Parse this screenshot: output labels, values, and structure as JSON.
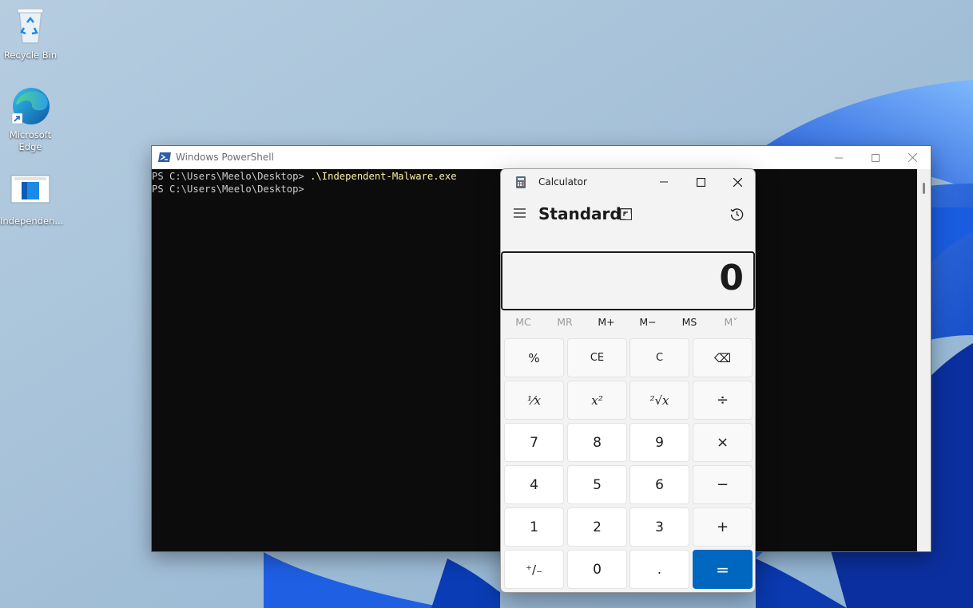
{
  "desktop": {
    "icons": [
      {
        "label": "Recycle Bin"
      },
      {
        "label": "Microsoft Edge"
      },
      {
        "label": "Independen..."
      }
    ]
  },
  "powershell": {
    "title": "Windows PowerShell",
    "lines": [
      "PS C:\\Users\\Meelo\\Desktop> .\\Independent-Malware.exe",
      "PS C:\\Users\\Meelo\\Desktop>"
    ],
    "controls": [
      "minimize-icon",
      "maximize-icon",
      "close-icon"
    ]
  },
  "calculator": {
    "title": "Calculator",
    "mode": "Standard",
    "display": "0",
    "memory": [
      {
        "label": "MC",
        "enabled": false
      },
      {
        "label": "MR",
        "enabled": false
      },
      {
        "label": "M+",
        "enabled": true
      },
      {
        "label": "M−",
        "enabled": true
      },
      {
        "label": "MS",
        "enabled": true
      },
      {
        "label": "M˅",
        "enabled": false
      }
    ],
    "keys": [
      {
        "label": "%"
      },
      {
        "label": "CE"
      },
      {
        "label": "C"
      },
      {
        "label": "⌫"
      },
      {
        "label": "⅟x"
      },
      {
        "label": "x²"
      },
      {
        "label": "²√x"
      },
      {
        "label": "÷"
      },
      {
        "label": "7"
      },
      {
        "label": "8"
      },
      {
        "label": "9"
      },
      {
        "label": "×"
      },
      {
        "label": "4"
      },
      {
        "label": "5"
      },
      {
        "label": "6"
      },
      {
        "label": "−"
      },
      {
        "label": "1"
      },
      {
        "label": "2"
      },
      {
        "label": "3"
      },
      {
        "label": "+"
      },
      {
        "label": "⁺/₋"
      },
      {
        "label": "0"
      },
      {
        "label": "."
      },
      {
        "label": "="
      }
    ]
  },
  "colors": {
    "accent": "#0067c0",
    "console_bg": "#0c0c0c",
    "console_command": "#f9f1a5"
  }
}
